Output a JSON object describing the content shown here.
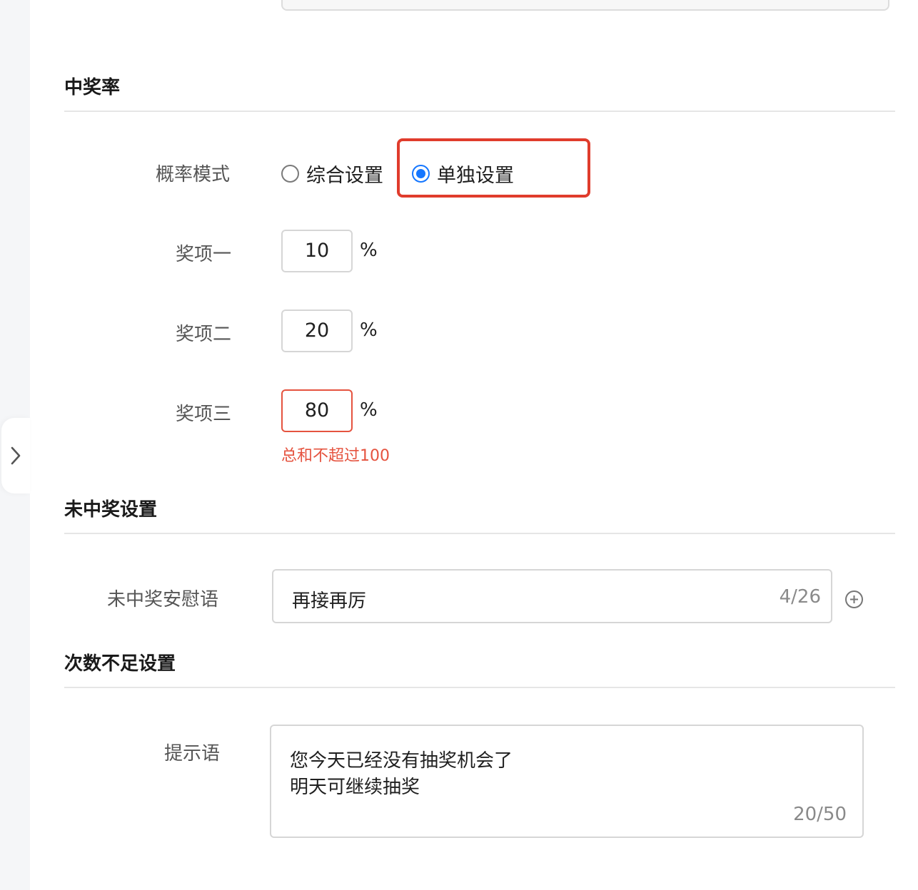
{
  "sections": {
    "win_rate": {
      "title": "中奖率",
      "mode_label": "概率模式",
      "mode_options": [
        "综合设置",
        "单独设置"
      ],
      "mode_selected": "单独设置",
      "prizes": [
        {
          "label": "奖项一",
          "value": "10",
          "unit": "%"
        },
        {
          "label": "奖项二",
          "value": "20",
          "unit": "%"
        },
        {
          "label": "奖项三",
          "value": "80",
          "unit": "%"
        }
      ],
      "error": "总和不超过100"
    },
    "no_win": {
      "title": "未中奖设置",
      "label": "未中奖安慰语",
      "value": "再接再厉",
      "counter": "4/26"
    },
    "insufficient": {
      "title": "次数不足设置",
      "label": "提示语",
      "lines": [
        "您今天已经没有抽奖机会了",
        "明天可继续抽奖"
      ],
      "counter": "20/50"
    }
  },
  "colors": {
    "primary": "#1677ff",
    "error": "#e5533f",
    "highlight": "#e03c2c"
  }
}
